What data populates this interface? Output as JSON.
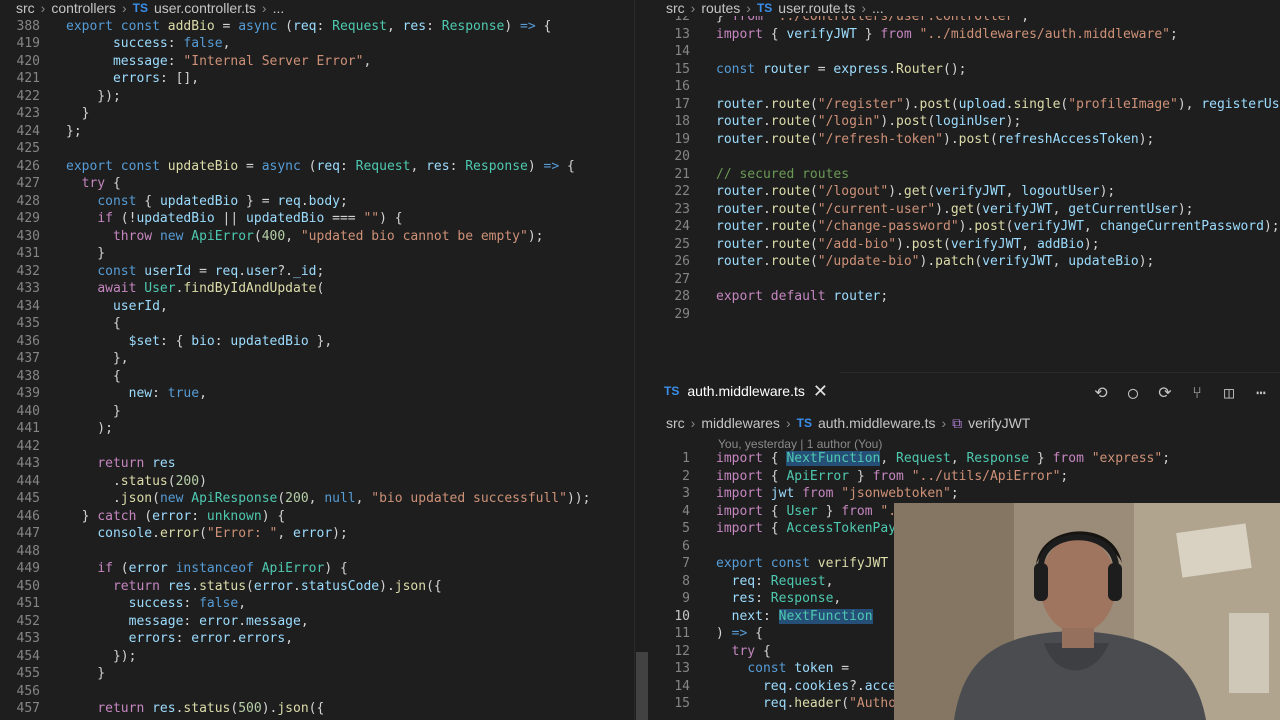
{
  "left": {
    "breadcrumb": [
      "src",
      "controllers",
      "user.controller.ts",
      "..."
    ],
    "sticky": [
      {
        "n": "388",
        "h": "<span class='kw'>export</span> <span class='kw'>const</span> <span class='fn'>addBio</span> = <span class='kw'>async</span> (<span class='var'>req</span>: <span class='cls'>Request</span>, <span class='var'>res</span>: <span class='cls'>Response</span>) <span class='kw'>=></span> {"
      }
    ],
    "lines": [
      {
        "n": "419",
        "h": "      <span class='var'>success</span>: <span class='kw'>false</span>,"
      },
      {
        "n": "420",
        "h": "      <span class='var'>message</span>: <span class='str'>\"Internal Server Error\"</span>,"
      },
      {
        "n": "421",
        "h": "      <span class='var'>errors</span>: [],"
      },
      {
        "n": "422",
        "h": "    });"
      },
      {
        "n": "423",
        "h": "  }"
      },
      {
        "n": "424",
        "h": "};"
      },
      {
        "n": "425",
        "h": ""
      },
      {
        "n": "426",
        "h": "<span class='kw'>export</span> <span class='kw'>const</span> <span class='fn'>updateBio</span> = <span class='kw'>async</span> (<span class='var'>req</span>: <span class='cls'>Request</span>, <span class='var'>res</span>: <span class='cls'>Response</span>) <span class='kw'>=></span> {"
      },
      {
        "n": "427",
        "h": "  <span class='ctl'>try</span> {"
      },
      {
        "n": "428",
        "h": "    <span class='kw'>const</span> { <span class='var'>updatedBio</span> } = <span class='var'>req</span>.<span class='var'>body</span>;"
      },
      {
        "n": "429",
        "h": "    <span class='ctl'>if</span> (!<span class='var'>updatedBio</span> || <span class='var'>updatedBio</span> === <span class='str'>\"\"</span>) {"
      },
      {
        "n": "430",
        "h": "      <span class='ctl'>throw</span> <span class='kw'>new</span> <span class='cls'>ApiError</span>(<span class='num-c'>400</span>, <span class='str'>\"updated bio cannot be empty\"</span>);"
      },
      {
        "n": "431",
        "h": "    }"
      },
      {
        "n": "432",
        "h": "    <span class='kw'>const</span> <span class='var'>userId</span> = <span class='var'>req</span>.<span class='var'>user</span>?.<span class='var'>_id</span>;"
      },
      {
        "n": "433",
        "h": "    <span class='ctl'>await</span> <span class='cls'>User</span>.<span class='fn'>findByIdAndUpdate</span>("
      },
      {
        "n": "434",
        "h": "      <span class='var'>userId</span>,"
      },
      {
        "n": "435",
        "h": "      {"
      },
      {
        "n": "436",
        "h": "        <span class='var'>$set</span>: { <span class='var'>bio</span>: <span class='var'>updatedBio</span> },"
      },
      {
        "n": "437",
        "h": "      },"
      },
      {
        "n": "438",
        "h": "      {"
      },
      {
        "n": "439",
        "h": "        <span class='var'>new</span>: <span class='kw'>true</span>,"
      },
      {
        "n": "440",
        "h": "      }"
      },
      {
        "n": "441",
        "h": "    );"
      },
      {
        "n": "442",
        "h": ""
      },
      {
        "n": "443",
        "h": "    <span class='ctl'>return</span> <span class='var'>res</span>"
      },
      {
        "n": "444",
        "h": "      .<span class='fn'>status</span>(<span class='num-c'>200</span>)"
      },
      {
        "n": "445",
        "h": "      .<span class='fn'>json</span>(<span class='kw'>new</span> <span class='cls'>ApiResponse</span>(<span class='num-c'>200</span>, <span class='kw'>null</span>, <span class='str'>\"bio updated successfull\"</span>));"
      },
      {
        "n": "446",
        "h": "  } <span class='ctl'>catch</span> (<span class='var'>error</span>: <span class='cls'>unknown</span>) {"
      },
      {
        "n": "447",
        "h": "    <span class='var'>console</span>.<span class='fn'>error</span>(<span class='str'>\"Error: \"</span>, <span class='var'>error</span>);"
      },
      {
        "n": "448",
        "h": ""
      },
      {
        "n": "449",
        "h": "    <span class='ctl'>if</span> (<span class='var'>error</span> <span class='kw'>instanceof</span> <span class='cls'>ApiError</span>) {"
      },
      {
        "n": "450",
        "h": "      <span class='ctl'>return</span> <span class='var'>res</span>.<span class='fn'>status</span>(<span class='var'>error</span>.<span class='var'>statusCode</span>).<span class='fn'>json</span>({"
      },
      {
        "n": "451",
        "h": "        <span class='var'>success</span>: <span class='kw'>false</span>,"
      },
      {
        "n": "452",
        "h": "        <span class='var'>message</span>: <span class='var'>error</span>.<span class='var'>message</span>,"
      },
      {
        "n": "453",
        "h": "        <span class='var'>errors</span>: <span class='var'>error</span>.<span class='var'>errors</span>,"
      },
      {
        "n": "454",
        "h": "      });"
      },
      {
        "n": "455",
        "h": "    }"
      },
      {
        "n": "456",
        "h": ""
      },
      {
        "n": "457",
        "h": "    <span class='ctl'>return</span> <span class='var'>res</span>.<span class='fn'>status</span>(<span class='num-c'>500</span>).<span class='fn'>json</span>({"
      }
    ]
  },
  "right_top": {
    "breadcrumb": [
      "src",
      "routes",
      "user.route.ts",
      "..."
    ],
    "lines": [
      {
        "n": "12",
        "h": "} <span class='ctl'>from</span> <span class='str'>\"../controllers/user.controller\"</span>;"
      },
      {
        "n": "13",
        "h": "<span class='ctl'>import</span> { <span class='var'>verifyJWT</span> } <span class='ctl'>from</span> <span class='str'>\"../middlewares/auth.middleware\"</span>;"
      },
      {
        "n": "14",
        "h": ""
      },
      {
        "n": "15",
        "h": "<span class='kw'>const</span> <span class='var'>router</span> = <span class='var'>express</span>.<span class='fn'>Router</span>();"
      },
      {
        "n": "16",
        "h": ""
      },
      {
        "n": "17",
        "h": "<span class='var'>router</span>.<span class='fn'>route</span>(<span class='str'>\"/register\"</span>).<span class='fn'>post</span>(<span class='var'>upload</span>.<span class='fn'>single</span>(<span class='str'>\"profileImage\"</span>), <span class='var'>registerUser</span>);"
      },
      {
        "n": "18",
        "h": "<span class='var'>router</span>.<span class='fn'>route</span>(<span class='str'>\"/login\"</span>).<span class='fn'>post</span>(<span class='var'>loginUser</span>);"
      },
      {
        "n": "19",
        "h": "<span class='var'>router</span>.<span class='fn'>route</span>(<span class='str'>\"/refresh-token\"</span>).<span class='fn'>post</span>(<span class='var'>refreshAccessToken</span>);"
      },
      {
        "n": "20",
        "h": ""
      },
      {
        "n": "21",
        "h": "<span class='cmt'>// secured routes</span>"
      },
      {
        "n": "22",
        "h": "<span class='var'>router</span>.<span class='fn'>route</span>(<span class='str'>\"/logout\"</span>).<span class='fn'>get</span>(<span class='var'>verifyJWT</span>, <span class='var'>logoutUser</span>);"
      },
      {
        "n": "23",
        "h": "<span class='var'>router</span>.<span class='fn'>route</span>(<span class='str'>\"/current-user\"</span>).<span class='fn'>get</span>(<span class='var'>verifyJWT</span>, <span class='var'>getCurrentUser</span>);"
      },
      {
        "n": "24",
        "h": "<span class='var'>router</span>.<span class='fn'>route</span>(<span class='str'>\"/change-password\"</span>).<span class='fn'>post</span>(<span class='var'>verifyJWT</span>, <span class='var'>changeCurrentPassword</span>);"
      },
      {
        "n": "25",
        "h": "<span class='var'>router</span>.<span class='fn'>route</span>(<span class='str'>\"/add-bio\"</span>).<span class='fn'>post</span>(<span class='var'>verifyJWT</span>, <span class='var'>addBio</span>);"
      },
      {
        "n": "26",
        "h": "<span class='var'>router</span>.<span class='fn'>route</span>(<span class='str'>\"/update-bio\"</span>).<span class='fn'>patch</span>(<span class='var'>verifyJWT</span>, <span class='var'>updateBio</span>);"
      },
      {
        "n": "27",
        "h": ""
      },
      {
        "n": "28",
        "h": "<span class='ctl'>export</span> <span class='ctl'>default</span> <span class='var'>router</span>;"
      },
      {
        "n": "29",
        "h": ""
      }
    ]
  },
  "right_bottom": {
    "tab": {
      "badge": "TS",
      "label": "auth.middleware.ts",
      "close": "✕"
    },
    "actions": [
      "go-back-icon",
      "circle-icon",
      "go-forward-icon",
      "source-control-icon",
      "split-editor-icon",
      "more-icon"
    ],
    "breadcrumb": [
      "src",
      "middlewares",
      "auth.middleware.ts",
      "verifyJWT"
    ],
    "blame": "You, yesterday | 1 author (You)",
    "lines": [
      {
        "n": "1",
        "h": "<span class='ctl'>import</span> { <span class='cls hl'>NextFunction</span>, <span class='cls'>Request</span>, <span class='cls'>Response</span> } <span class='ctl'>from</span> <span class='str'>\"express\"</span>;"
      },
      {
        "n": "2",
        "h": "<span class='ctl'>import</span> { <span class='cls'>ApiError</span> } <span class='ctl'>from</span> <span class='str'>\"../utils/ApiError\"</span>;"
      },
      {
        "n": "3",
        "h": "<span class='ctl'>import</span> <span class='var'>jwt</span> <span class='ctl'>from</span> <span class='str'>\"jsonwebtoken\"</span>;"
      },
      {
        "n": "4",
        "h": "<span class='ctl'>import</span> { <span class='cls'>User</span> } <span class='ctl'>from</span> <span class='str'>\".</span>"
      },
      {
        "n": "5",
        "h": "<span class='ctl'>import</span> { <span class='cls'>AccessTokenPay</span>"
      },
      {
        "n": "6",
        "h": ""
      },
      {
        "n": "7",
        "h": "<span class='kw'>export</span> <span class='kw'>const</span> <span class='fn'>verifyJWT</span> ="
      },
      {
        "n": "8",
        "h": "  <span class='var'>req</span>: <span class='cls'>Request</span>,"
      },
      {
        "n": "9",
        "h": "  <span class='var'>res</span>: <span class='cls'>Response</span>,"
      },
      {
        "n": "10",
        "h": "  <span class='var'>next</span>: <span class='cls hl'>NextFunction</span>",
        "cur": true
      },
      {
        "n": "11",
        "h": ") <span class='kw'>=></span> {"
      },
      {
        "n": "12",
        "h": "  <span class='ctl'>try</span> {"
      },
      {
        "n": "13",
        "h": "    <span class='kw'>const</span> <span class='var'>token</span> ="
      },
      {
        "n": "14",
        "h": "      <span class='var'>req</span>.<span class='var'>cookies</span>?.<span class='var'>acces</span>"
      },
      {
        "n": "15",
        "h": "      <span class='var'>req</span>.<span class='fn'>header</span>(<span class='str'>\"Author</span>"
      }
    ]
  }
}
